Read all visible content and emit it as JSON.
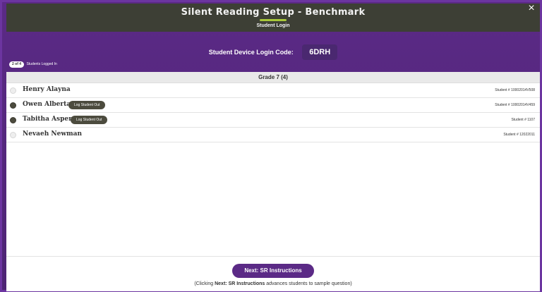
{
  "header": {
    "title": "Silent Reading Setup - Benchmark",
    "subtitle": "Student Login",
    "accent_color": "#a8c83a"
  },
  "close_icon": "×",
  "login": {
    "label": "Student Device Login Code:",
    "code": "6DRH"
  },
  "logged_in": {
    "count": "2 of 4",
    "label": "Students Logged In"
  },
  "grade": {
    "title": "Grade 7 (4)"
  },
  "students": [
    {
      "name": "Henry Alayna",
      "logged_in": false,
      "number": "Student # 10002014V508",
      "logout_label": ""
    },
    {
      "name": "Owen Alberta",
      "logged_in": true,
      "number": "Student # 10002014V459",
      "logout_label": "Log Student Out"
    },
    {
      "name": "Tabitha Aspen",
      "logged_in": true,
      "number": "Student # 1107",
      "logout_label": "Log Student Out"
    },
    {
      "name": "Nevaeh Newman",
      "logged_in": false,
      "number": "Student # 12022011",
      "logout_label": ""
    }
  ],
  "footer": {
    "next_label": "Next: SR Instructions",
    "hint_prefix": "(Clicking ",
    "hint_bold": "Next:",
    "hint_middle": " SR Instructions",
    "hint_suffix": " advances students to sample question)"
  },
  "colors": {
    "purple": "#5b2a86",
    "header_bg": "#3d3f35",
    "dark_pill": "#4c4b3e"
  }
}
